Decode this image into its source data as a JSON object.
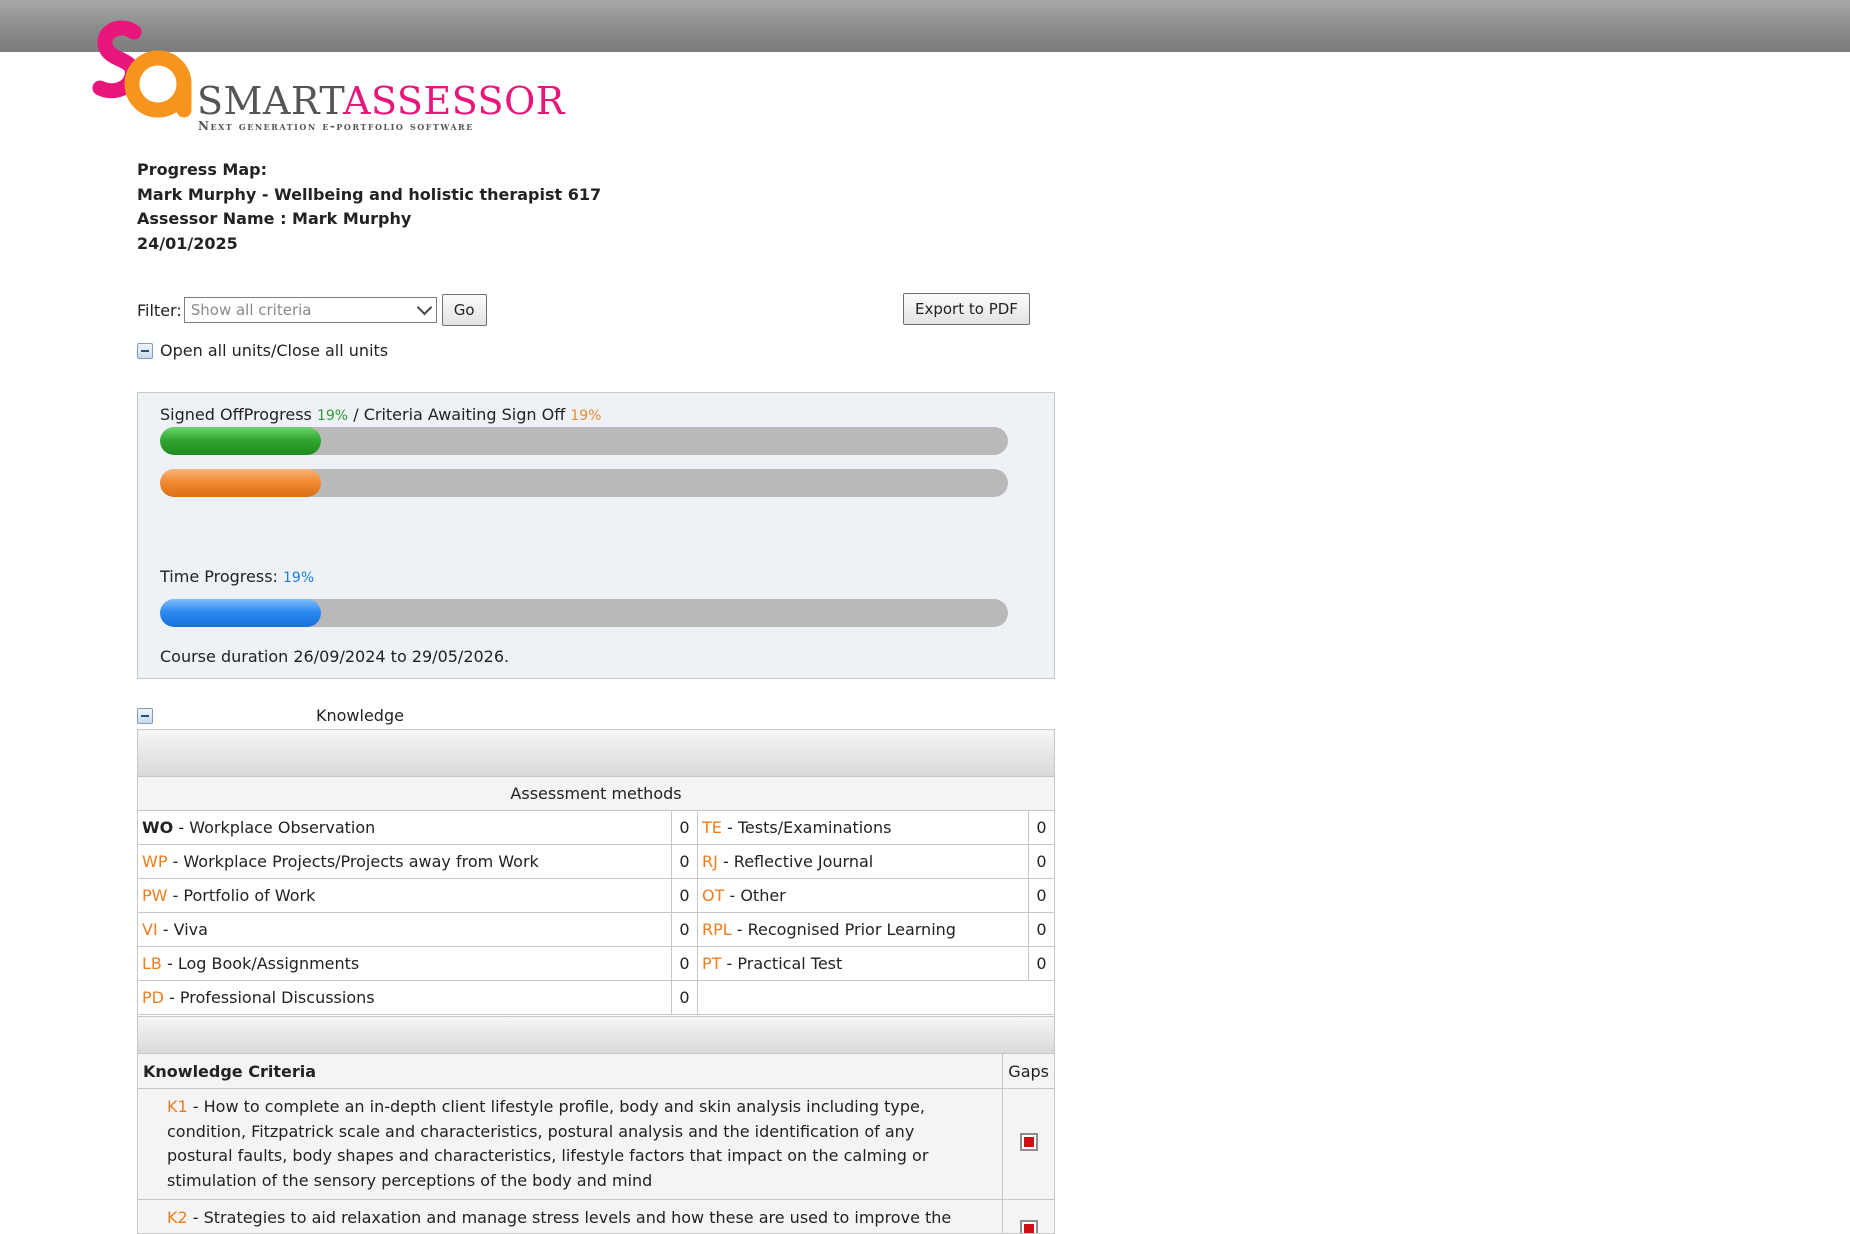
{
  "logo": {
    "word_part1": "SMART",
    "word_part2": "ASSESSOR",
    "tagline": "Next generation e-portfolio software"
  },
  "header": {
    "title_line": "Progress Map:",
    "learner_line": "Mark Murphy - Wellbeing and holistic therapist 617",
    "assessor_line": "Assessor Name : Mark Murphy",
    "date_line": "24/01/2025"
  },
  "filter": {
    "label": "Filter:",
    "selected": "Show all criteria",
    "go_label": "Go",
    "export_label": "Export to PDF"
  },
  "toggle_all_label": "Open all units/Close all units",
  "progress": {
    "signed_off_label": "Signed OffProgress",
    "signed_off_pct": "19%",
    "separator": "/",
    "awaiting_label": "Criteria Awaiting Sign Off",
    "awaiting_pct": "19%",
    "signed_off_fraction": 0.19,
    "awaiting_fraction": 0.19,
    "time_label": "Time Progress:",
    "time_pct": "19%",
    "time_fraction": 0.19,
    "course_duration": "Course duration 26/09/2024 to 29/05/2026."
  },
  "unit": {
    "title": "Knowledge",
    "assessment_methods_header": "Assessment methods",
    "methods": [
      {
        "left_code": "WO",
        "left_label": "- Workplace Observation",
        "left_count": "0",
        "right_code": "TE",
        "right_label": "- Tests/Examinations",
        "right_count": "0"
      },
      {
        "left_code": "WP",
        "left_label": "- Workplace Projects/Projects away from Work",
        "left_count": "0",
        "right_code": "RJ",
        "right_label": "- Reflective Journal",
        "right_count": "0"
      },
      {
        "left_code": "PW",
        "left_label": "- Portfolio of Work",
        "left_count": "0",
        "right_code": "OT",
        "right_label": "- Other",
        "right_count": "0"
      },
      {
        "left_code": "VI",
        "left_label": "- Viva",
        "left_count": "0",
        "right_code": "RPL",
        "right_label": "- Recognised Prior Learning",
        "right_count": "0"
      },
      {
        "left_code": "LB",
        "left_label": "- Log Book/Assignments",
        "left_count": "0",
        "right_code": "PT",
        "right_label": "- Practical Test",
        "right_count": "0"
      },
      {
        "left_code": "PD",
        "left_label": "- Professional Discussions",
        "left_count": "0",
        "right_code": "",
        "right_label": "",
        "right_count": ""
      }
    ],
    "criteria_header": "Knowledge Criteria",
    "gaps_header": "Gaps",
    "criteria": [
      {
        "code": "K1",
        "text": "- How to complete an in-depth client lifestyle profile, body and skin analysis including type, condition, Fitzpatrick scale and characteristics, postural analysis and the identification of any postural faults, body shapes and characteristics, lifestyle factors that impact on the calming or stimulation of the sensory perceptions of the body and mind"
      },
      {
        "code": "K2",
        "text": "- Strategies to aid relaxation and manage stress levels and how these are used to improve the client's physical and emotional welfare"
      }
    ]
  },
  "colors": {
    "accent_orange": "#ee7d1e",
    "brand_pink": "#e8157a",
    "brand_orange": "#f7941d",
    "signed_green": "#32a832",
    "time_blue": "#2e8bf0",
    "gap_red": "#d01010"
  }
}
